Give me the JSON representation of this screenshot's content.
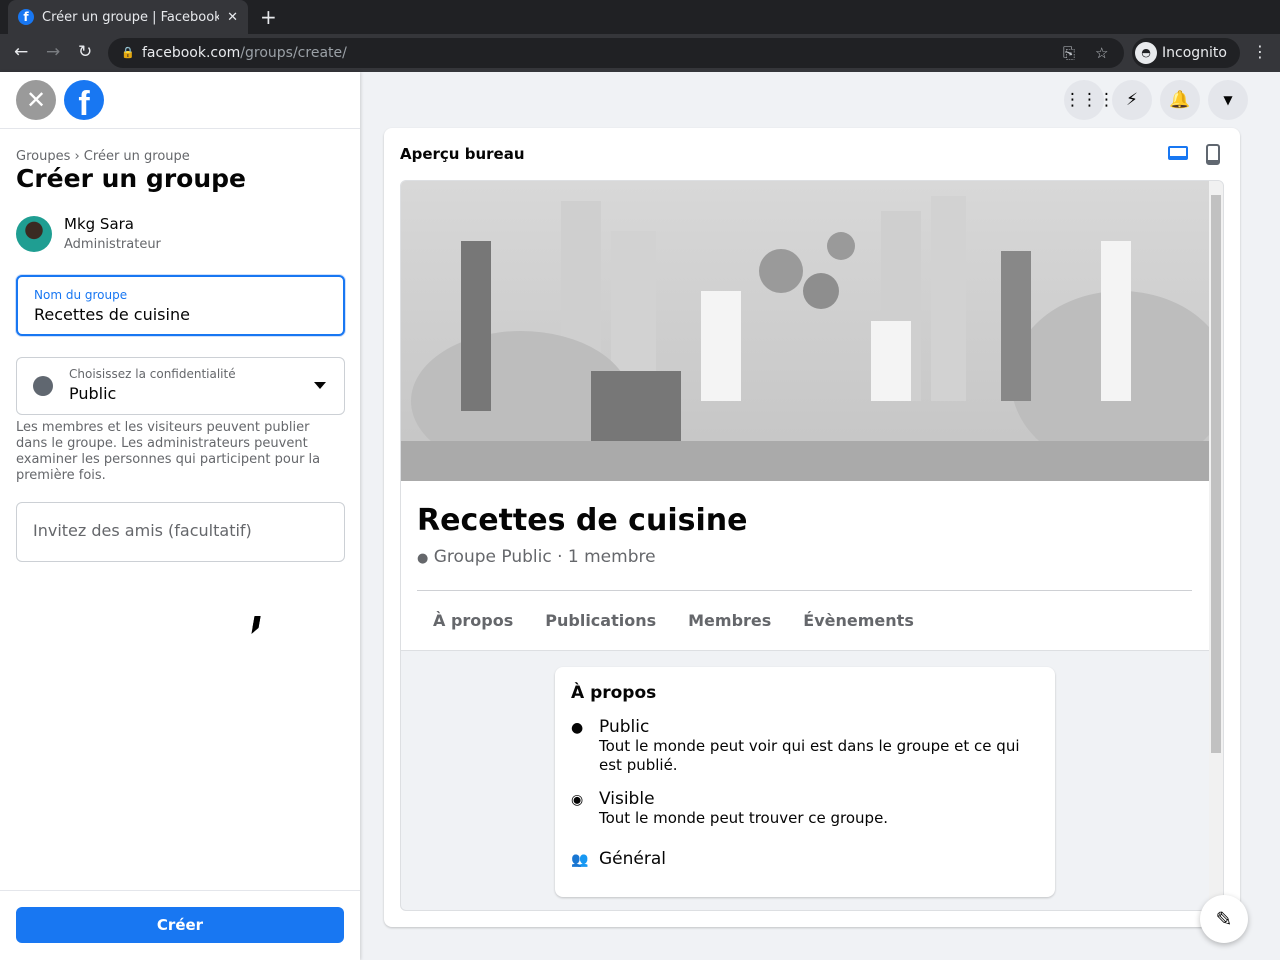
{
  "browser": {
    "tab_title": "Créer un groupe | Facebook",
    "url_domain": "facebook.com",
    "url_path": "/groups/create/",
    "incognito_label": "Incognito"
  },
  "left": {
    "breadcrumb": "Groupes › Créer un groupe",
    "title": "Créer un groupe",
    "user_name": "Mkg Sara",
    "user_role": "Administrateur",
    "name_label": "Nom du groupe",
    "name_value": "Recettes de cuisine",
    "privacy_label": "Choisissez la confidentialité",
    "privacy_value": "Public",
    "privacy_help": "Les membres et les visiteurs peuvent publier dans le groupe. Les administrateurs peuvent examiner les personnes qui participent pour la première fois.",
    "invite_placeholder": "Invitez des amis (facultatif)",
    "create_button": "Créer"
  },
  "preview": {
    "title": "Aperçu bureau",
    "group_name": "Recettes de cuisine",
    "group_meta": "Groupe Public · 1 membre",
    "tabs": [
      "À propos",
      "Publications",
      "Membres",
      "Évènements"
    ],
    "about": {
      "title": "À propos",
      "items": [
        {
          "heading": "Public",
          "desc": "Tout le monde peut voir qui est dans le groupe et ce qui est publié."
        },
        {
          "heading": "Visible",
          "desc": "Tout le monde peut trouver ce groupe."
        },
        {
          "heading": "Général",
          "desc": ""
        }
      ]
    }
  },
  "colors": {
    "accent": "#1877f2"
  }
}
